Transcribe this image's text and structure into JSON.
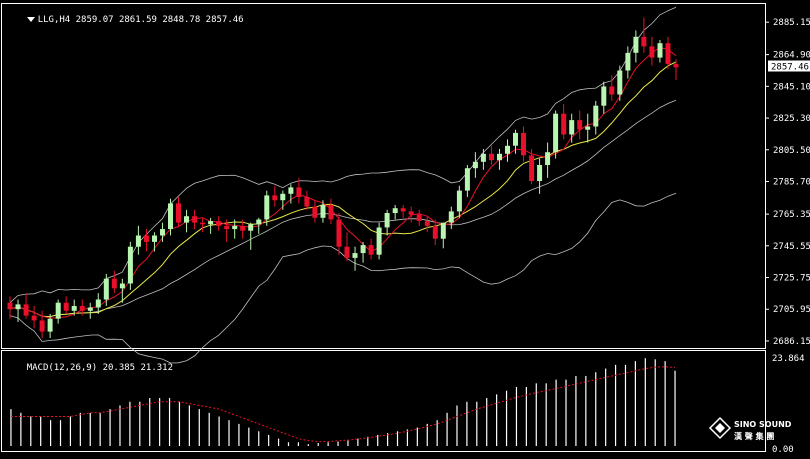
{
  "header": {
    "symbol_label": "LLG,H4",
    "ohlc_text": "2859.07 2861.59 2848.78 2857.46"
  },
  "macd_header": {
    "label": "MACD(12,26,9)",
    "values_text": "20.385 21.312"
  },
  "price_axis": {
    "ticks": [
      "2885.15",
      "2864.90",
      "2845.10",
      "2825.30",
      "2805.50",
      "2785.70",
      "2765.35",
      "2745.55",
      "2725.75",
      "2705.95",
      "2686.15"
    ],
    "current_label": "2857.46"
  },
  "macd_axis": {
    "top_label": "23.864",
    "bottom_label": "0.00"
  },
  "watermark": {
    "line1": "SINO SOUND",
    "line2": "漢 聲 集 團"
  },
  "colors": {
    "background": "#000000",
    "up_candle": "#b8f5b0",
    "down_candle": "#e8102a",
    "ma_fast": "#e8102a",
    "ma_slow": "#e8e84a",
    "bollinger": "#c0c0c0",
    "macd_hist": "#ffffff",
    "macd_signal": "#e8102a",
    "frame": "#ffffff"
  },
  "chart_data": [
    {
      "type": "candlestick",
      "title": "LLG,H4",
      "ylim": [
        2686.15,
        2894.0
      ],
      "indicators": [
        "Bollinger Bands",
        "Moving average (red)",
        "Moving average (yellow)"
      ],
      "ohlc": [
        [
          2710,
          2714,
          2700,
          2706
        ],
        [
          2706,
          2712,
          2698,
          2709
        ],
        [
          2709,
          2716,
          2700,
          2702
        ],
        [
          2702,
          2708,
          2694,
          2699
        ],
        [
          2699,
          2705,
          2688,
          2692
        ],
        [
          2692,
          2703,
          2688,
          2700
        ],
        [
          2700,
          2712,
          2697,
          2710
        ],
        [
          2710,
          2714,
          2703,
          2705
        ],
        [
          2705,
          2712,
          2702,
          2708
        ],
        [
          2708,
          2712,
          2702,
          2705
        ],
        [
          2705,
          2710,
          2700,
          2707
        ],
        [
          2707,
          2716,
          2703,
          2712
        ],
        [
          2712,
          2728,
          2708,
          2725
        ],
        [
          2725,
          2730,
          2716,
          2719
        ],
        [
          2719,
          2725,
          2710,
          2722
        ],
        [
          2722,
          2748,
          2718,
          2745
        ],
        [
          2745,
          2758,
          2740,
          2752
        ],
        [
          2752,
          2756,
          2742,
          2748
        ],
        [
          2748,
          2754,
          2742,
          2752
        ],
        [
          2752,
          2760,
          2748,
          2756
        ],
        [
          2756,
          2775,
          2752,
          2772
        ],
        [
          2772,
          2776,
          2757,
          2760
        ],
        [
          2760,
          2768,
          2754,
          2764
        ],
        [
          2764,
          2768,
          2756,
          2760
        ],
        [
          2760,
          2763,
          2754,
          2759
        ],
        [
          2759,
          2763,
          2753,
          2761
        ],
        [
          2761,
          2764,
          2755,
          2758
        ],
        [
          2758,
          2762,
          2748,
          2756
        ],
        [
          2756,
          2762,
          2750,
          2758
        ],
        [
          2758,
          2762,
          2750,
          2755
        ],
        [
          2755,
          2760,
          2743,
          2759
        ],
        [
          2759,
          2763,
          2753,
          2762
        ],
        [
          2762,
          2780,
          2758,
          2777
        ],
        [
          2777,
          2783,
          2770,
          2774
        ],
        [
          2774,
          2780,
          2768,
          2778
        ],
        [
          2778,
          2784,
          2772,
          2782
        ],
        [
          2782,
          2788,
          2772,
          2776
        ],
        [
          2776,
          2780,
          2768,
          2770
        ],
        [
          2770,
          2774,
          2760,
          2763
        ],
        [
          2763,
          2774,
          2760,
          2771
        ],
        [
          2771,
          2775,
          2759,
          2762
        ],
        [
          2762,
          2766,
          2740,
          2745
        ],
        [
          2745,
          2754,
          2736,
          2738
        ],
        [
          2738,
          2745,
          2730,
          2741
        ],
        [
          2741,
          2748,
          2735,
          2746
        ],
        [
          2746,
          2750,
          2737,
          2740
        ],
        [
          2740,
          2760,
          2737,
          2757
        ],
        [
          2757,
          2768,
          2752,
          2766
        ],
        [
          2766,
          2771,
          2762,
          2769
        ],
        [
          2769,
          2771,
          2763,
          2767
        ],
        [
          2767,
          2770,
          2760,
          2765
        ],
        [
          2765,
          2768,
          2758,
          2761
        ],
        [
          2761,
          2764,
          2754,
          2758
        ],
        [
          2758,
          2762,
          2746,
          2750
        ],
        [
          2750,
          2760,
          2744,
          2760
        ],
        [
          2760,
          2770,
          2756,
          2767
        ],
        [
          2767,
          2783,
          2763,
          2780
        ],
        [
          2780,
          2796,
          2776,
          2794
        ],
        [
          2794,
          2804,
          2788,
          2798
        ],
        [
          2798,
          2806,
          2793,
          2803
        ],
        [
          2803,
          2808,
          2796,
          2799
        ],
        [
          2799,
          2806,
          2793,
          2803
        ],
        [
          2803,
          2812,
          2798,
          2808
        ],
        [
          2808,
          2818,
          2803,
          2816
        ],
        [
          2816,
          2820,
          2798,
          2802
        ],
        [
          2802,
          2806,
          2784,
          2786
        ],
        [
          2786,
          2800,
          2778,
          2796
        ],
        [
          2796,
          2810,
          2788,
          2804
        ],
        [
          2804,
          2830,
          2800,
          2828
        ],
        [
          2828,
          2834,
          2812,
          2815
        ],
        [
          2815,
          2828,
          2810,
          2824
        ],
        [
          2824,
          2830,
          2812,
          2818
        ],
        [
          2818,
          2828,
          2810,
          2820
        ],
        [
          2820,
          2836,
          2815,
          2833
        ],
        [
          2833,
          2848,
          2828,
          2845
        ],
        [
          2845,
          2852,
          2836,
          2840
        ],
        [
          2840,
          2858,
          2836,
          2855
        ],
        [
          2855,
          2870,
          2850,
          2866
        ],
        [
          2866,
          2880,
          2860,
          2876
        ],
        [
          2876,
          2888,
          2866,
          2870
        ],
        [
          2870,
          2876,
          2858,
          2863
        ],
        [
          2863,
          2874,
          2860,
          2872
        ],
        [
          2872,
          2876,
          2856,
          2859
        ],
        [
          2859,
          2862,
          2849,
          2857
        ]
      ]
    },
    {
      "type": "bar",
      "title": "MACD(12,26,9)",
      "series": [
        {
          "name": "MACD",
          "values": [
            10,
            9,
            8,
            8,
            7,
            7,
            8,
            9,
            9,
            9,
            10,
            11,
            12,
            12,
            13,
            13,
            13,
            12,
            11,
            10,
            9,
            8,
            7,
            6,
            5,
            4,
            3,
            2,
            1,
            1,
            0.5,
            0.8,
            1,
            1.2,
            1.5,
            2,
            2.5,
            3,
            3.5,
            4,
            4.5,
            5,
            6,
            7,
            9,
            11,
            12,
            12,
            13,
            14,
            15,
            16,
            16,
            17,
            17,
            18,
            18,
            19,
            19,
            20,
            21,
            22,
            22,
            23,
            23.8,
            23.5,
            23,
            20.4
          ]
        },
        {
          "name": "Signal",
          "values": [
            8,
            8,
            8,
            8,
            8,
            8,
            8,
            8.5,
            9,
            9,
            9.5,
            10,
            10.5,
            11,
            11.5,
            12,
            12,
            12,
            11.5,
            11,
            10.5,
            10,
            9,
            8,
            7,
            6,
            5,
            4,
            3,
            2,
            1.5,
            1.2,
            1.2,
            1.4,
            1.6,
            1.9,
            2.2,
            2.6,
            3,
            3.5,
            4,
            4.6,
            5.3,
            6,
            7,
            8,
            9,
            10,
            10.8,
            11.6,
            12.4,
            13.2,
            13.8,
            14.5,
            15,
            15.6,
            16.2,
            16.8,
            17.4,
            18,
            18.6,
            19.2,
            19.8,
            20.4,
            21,
            21.4,
            21.5,
            21.3
          ]
        }
      ],
      "ylim": [
        0.0,
        23.864
      ]
    }
  ]
}
